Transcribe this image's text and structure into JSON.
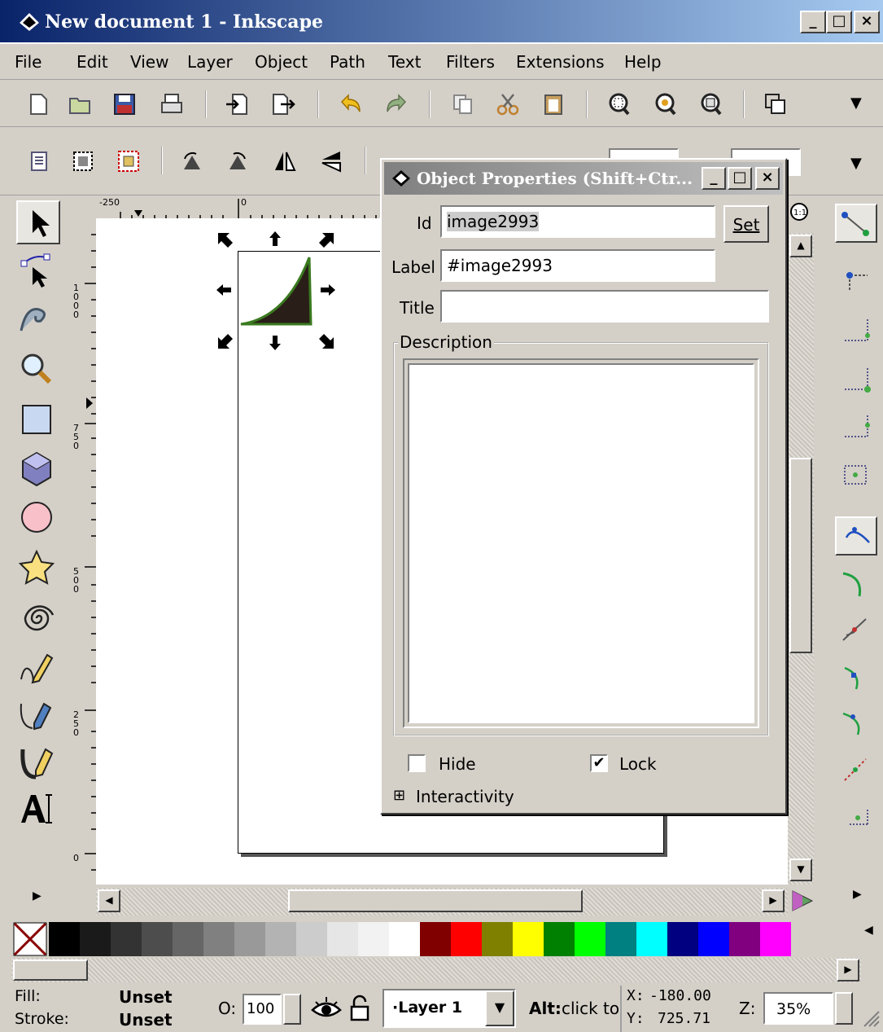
{
  "window": {
    "title": "New document 1 - Inkscape",
    "min": "_",
    "max": "□",
    "close": "×"
  },
  "menu": [
    "File",
    "Edit",
    "View",
    "Layer",
    "Object",
    "Path",
    "Text",
    "Filters",
    "Extensions",
    "Help"
  ],
  "ruler": {
    "h_labels": [
      "-250",
      "0"
    ],
    "v_labels": [
      "1000",
      "750",
      "500",
      "250",
      "0"
    ]
  },
  "dialog": {
    "title": "Object Properties (Shift+Ctr...",
    "id_label": "Id",
    "id_value": "image2993",
    "set_label": "Set",
    "label_label": "Label",
    "label_value": "#image2993",
    "title_label": "Title",
    "title_value": "",
    "description_label": "Description",
    "hide_label": "Hide",
    "hide_checked": false,
    "lock_label": "Lock",
    "lock_checked": true,
    "interactivity_label": "Interactivity",
    "expander": "⊞"
  },
  "status": {
    "fill_label": "Fill:",
    "fill_value": "Unset",
    "stroke_label": "Stroke:",
    "stroke_value": "Unset",
    "opacity_label": "O:",
    "opacity_value": "100",
    "layer": "·Layer 1",
    "message_bold": "Alt:",
    "message": " click to",
    "x_label": "X:",
    "x_value": "-180.00",
    "y_label": "Y:",
    "y_value": "725.71",
    "zoom_label": "Z:",
    "zoom_value": "35%"
  },
  "palette": [
    "#000000",
    "#1a1a1a",
    "#333333",
    "#4d4d4d",
    "#666666",
    "#808080",
    "#999999",
    "#b3b3b3",
    "#cccccc",
    "#e6e6e6",
    "#f2f2f2",
    "#ffffff",
    "#800000",
    "#ff0000",
    "#808000",
    "#ffff00",
    "#008000",
    "#00ff00",
    "#008080",
    "#00ffff",
    "#000080",
    "#0000ff",
    "#800080",
    "#ff00ff"
  ],
  "icons": {
    "checkmark": "✔",
    "triangle_right": "▶",
    "arrow_left": "◀",
    "arrow_up": "▲",
    "arrow_down": "▼",
    "more": "▾"
  }
}
